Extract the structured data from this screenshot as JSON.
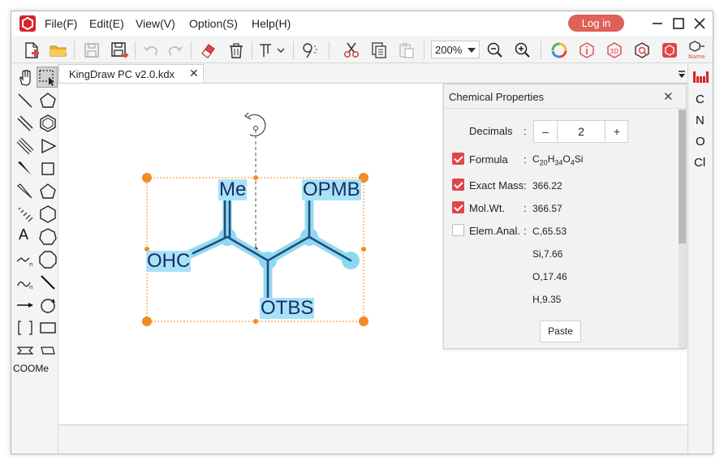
{
  "menu": {
    "file": "File(F)",
    "edit": "Edit(E)",
    "view": "View(V)",
    "option": "Option(S)",
    "help": "Help(H)",
    "login": "Log in"
  },
  "toolbar": {
    "zoom": "200%",
    "name_label": "Name"
  },
  "palette": {
    "text_tool": "A",
    "coome_label": "COOMe"
  },
  "tab": {
    "title": "KingDraw PC v2.0.kdx",
    "close": "✕"
  },
  "molecule": {
    "labels": {
      "me": "Me",
      "opmb": "OPMB",
      "ohc": "OHC",
      "otbs": "OTBS"
    },
    "colors": {
      "bond": "#1d4f7a",
      "highlight": "#8fd8f2",
      "selection": "#f38a22"
    }
  },
  "elements": [
    "C",
    "N",
    "O",
    "Cl"
  ],
  "properties": {
    "title": "Chemical Properties",
    "close": "✕",
    "decimals_label": "Decimals",
    "decimals_value": "2",
    "minus": "–",
    "plus": "+",
    "formula_label": "Formula",
    "formula": {
      "c": "C",
      "c_n": "20",
      "h": "H",
      "h_n": "34",
      "o": "O",
      "o_n": "4",
      "si": "Si"
    },
    "exact_mass_label": "Exact Mass",
    "exact_mass": "366.22",
    "mol_wt_label": "Mol.Wt.",
    "mol_wt": "366.57",
    "elem_anal_label": "Elem.Anal.",
    "elem_anal": [
      "C,65.53",
      "Si,7.66",
      "O,17.46",
      "H,9.35"
    ],
    "paste": "Paste",
    "checkbox_formula": true,
    "checkbox_exact_mass": true,
    "checkbox_mol_wt": true,
    "checkbox_elem_anal": false
  },
  "accent_color": "#e0464a"
}
